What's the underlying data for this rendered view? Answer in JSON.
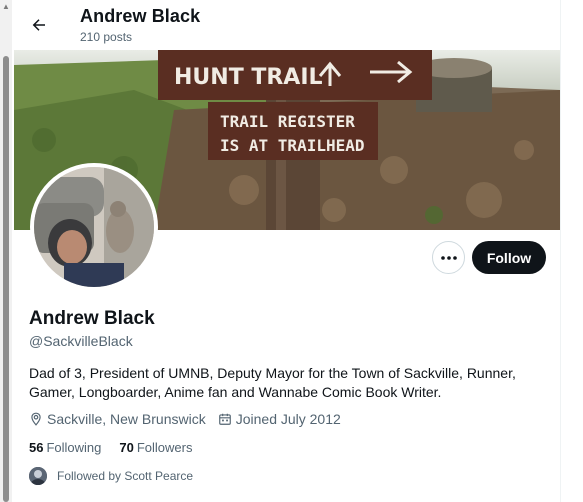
{
  "header": {
    "name": "Andrew Black",
    "posts": "210 posts"
  },
  "banner": {
    "sign_top": "HUNT TRAIL",
    "sign_bottom_line1": "TRAIL REGISTER",
    "sign_bottom_line2": "IS AT TRAILHEAD"
  },
  "actions": {
    "more_label": "•••",
    "follow_label": "Follow"
  },
  "profile": {
    "name": "Andrew Black",
    "handle": "@SackvilleBlack",
    "bio": "Dad of 3, President of UMNB, Deputy Mayor for the Town of Sackville, Runner, Gamer, Longboarder, Anime fan and Wannabe Comic Book Writer.",
    "location": "Sackville, New Brunswick",
    "joined": "Joined July 2012"
  },
  "stats": {
    "following_count": "56",
    "following_label": "Following",
    "followers_count": "70",
    "followers_label": "Followers"
  },
  "followed_by": "Followed by Scott Pearce",
  "colors": {
    "text": "#0f1419",
    "secondary": "#536471",
    "follow_bg": "#0f1419",
    "sign_brown": "#5a2e22"
  }
}
